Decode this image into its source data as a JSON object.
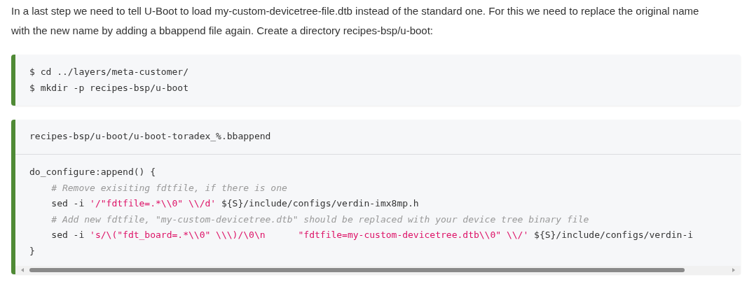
{
  "paragraph": "In a last step we need to tell U-Boot to load my-custom-devicetree-file.dtb instead of the standard one. For this we need to replace the original name with the new name by adding a bbappend file again. Create a directory recipes-bsp/u-boot:",
  "code_blocks": [
    {
      "lines": [
        [
          {
            "kind": "plain",
            "text": "$ cd ../layers/meta-customer/"
          }
        ],
        [
          {
            "kind": "plain",
            "text": "$ mkdir -p recipes-bsp/u-boot"
          }
        ]
      ]
    },
    {
      "filename": "recipes-bsp/u-boot/u-boot-toradex_%.bbappend",
      "lines": [
        [
          {
            "kind": "plain",
            "text": "do_configure:append() {"
          }
        ],
        [
          {
            "kind": "comment",
            "text": "    # Remove exisiting fdtfile, if there is one"
          }
        ],
        [
          {
            "kind": "plain",
            "text": "    sed -i "
          },
          {
            "kind": "string",
            "text": "'/\"fdtfile=.*\\\\0\" \\\\/d'"
          },
          {
            "kind": "plain",
            "text": " ${S}/include/configs/verdin-imx8mp.h"
          }
        ],
        [
          {
            "kind": "comment",
            "text": "    # Add new fdtfile, \"my-custom-devicetree.dtb\" should be replaced with your device tree binary file"
          }
        ],
        [
          {
            "kind": "plain",
            "text": "    sed -i "
          },
          {
            "kind": "string",
            "text": "'s/\\(\"fdt_board=.*\\\\0\" \\\\\\)/\\0\\n      \"fdtfile=my-custom-devicetree.dtb\\\\0\" \\\\/'"
          },
          {
            "kind": "plain",
            "text": " ${S}/include/configs/verdin-i"
          }
        ],
        [
          {
            "kind": "plain",
            "text": "}"
          }
        ]
      ]
    }
  ]
}
